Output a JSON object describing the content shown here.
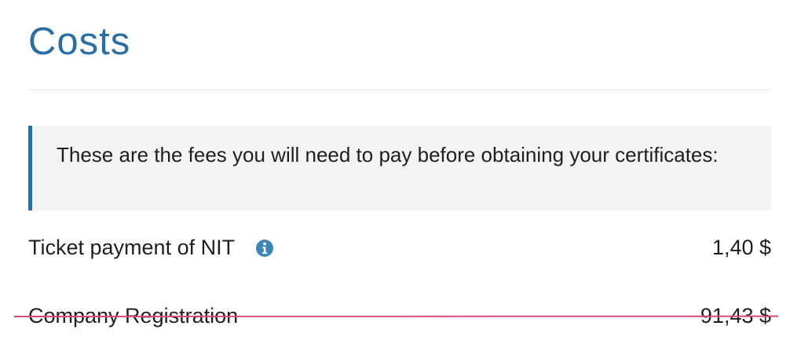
{
  "section": {
    "title": "Costs",
    "notice": "These are the fees you will need to pay before obtaining your certificates:"
  },
  "costs": [
    {
      "label": "Ticket payment of NIT",
      "amount": "1,40 $",
      "info_icon": "info-icon",
      "status": "active"
    },
    {
      "label": "Company Registration",
      "amount": "91,43 $",
      "status": "strikethrough"
    }
  ],
  "colors": {
    "accent": "#2a6ea6",
    "info_icon": "#3b86b5",
    "notice_background": "#f3f3f3",
    "strike_line": "#d94b76",
    "text": "#1f1f1f"
  }
}
